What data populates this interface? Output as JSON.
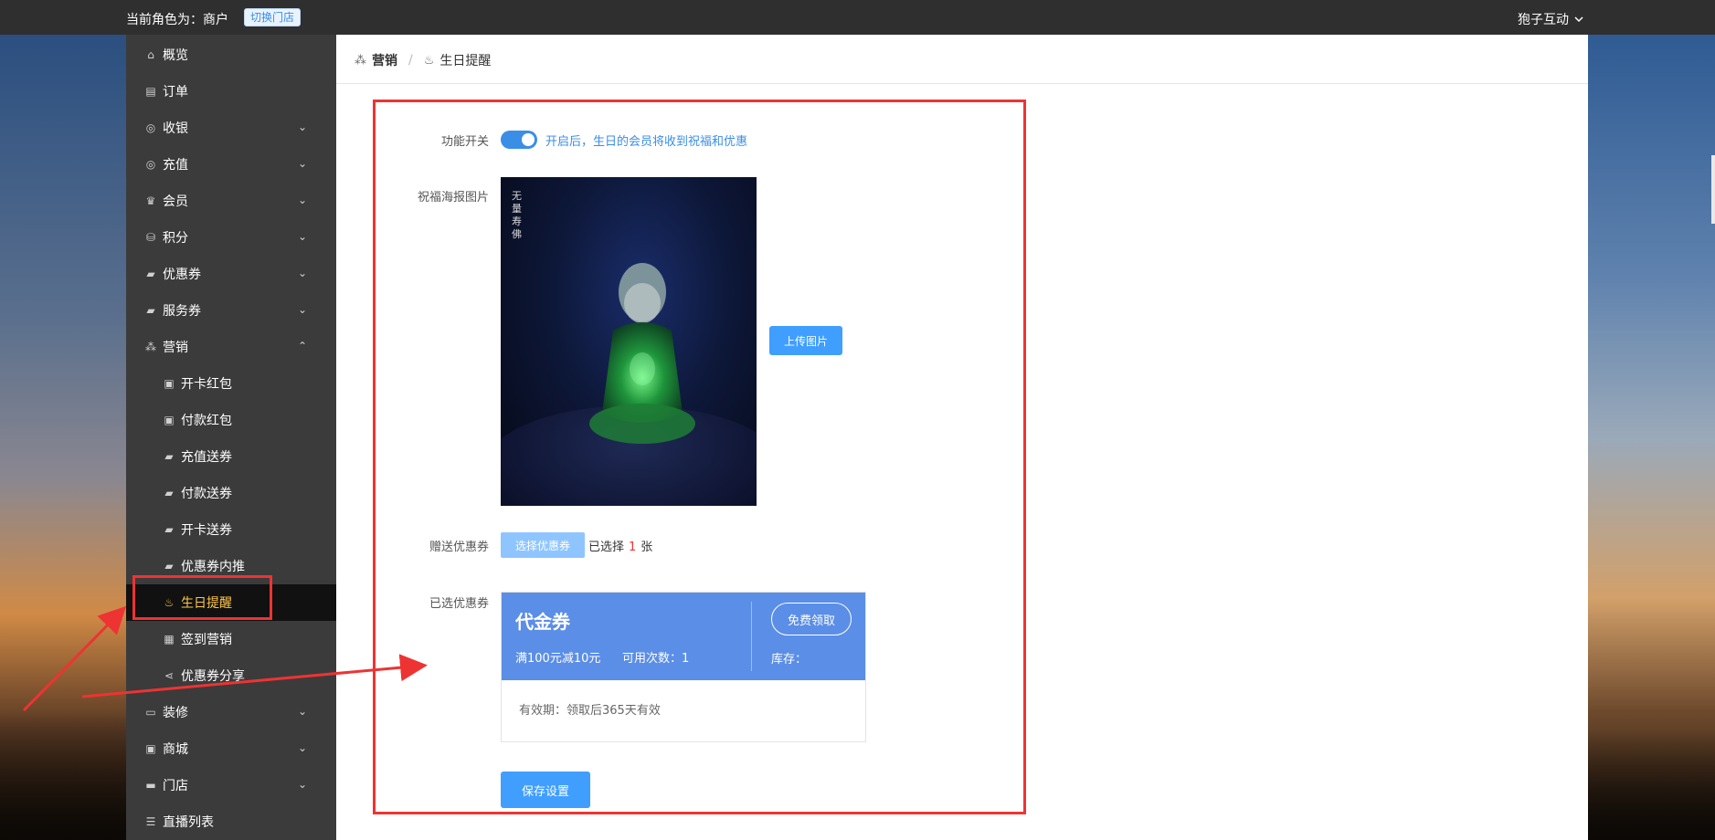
{
  "topbar": {
    "role_text": "当前角色为：商户",
    "switch_store": "切换门店",
    "user_name": "狍子互动"
  },
  "sidebar": {
    "items": [
      {
        "label": "概览",
        "icon": "home-icon",
        "has_chevron": false
      },
      {
        "label": "订单",
        "icon": "order-icon",
        "has_chevron": false
      },
      {
        "label": "收银",
        "icon": "cashier-icon",
        "has_chevron": true
      },
      {
        "label": "充值",
        "icon": "recharge-icon",
        "has_chevron": true
      },
      {
        "label": "会员",
        "icon": "member-icon",
        "has_chevron": true
      },
      {
        "label": "积分",
        "icon": "points-icon",
        "has_chevron": true
      },
      {
        "label": "优惠券",
        "icon": "coupon-icon",
        "has_chevron": true
      },
      {
        "label": "服务券",
        "icon": "service-coupon-icon",
        "has_chevron": true
      },
      {
        "label": "营销",
        "icon": "marketing-icon",
        "has_chevron": true,
        "expanded": true
      }
    ],
    "marketing_sub": [
      {
        "label": "开卡红包",
        "icon": "redpacket-icon"
      },
      {
        "label": "付款红包",
        "icon": "redpacket-icon"
      },
      {
        "label": "充值送券",
        "icon": "ticket-icon"
      },
      {
        "label": "付款送券",
        "icon": "ticket-icon"
      },
      {
        "label": "开卡送券",
        "icon": "ticket-icon"
      },
      {
        "label": "优惠券内推",
        "icon": "ticket-icon"
      },
      {
        "label": "生日提醒",
        "icon": "cake-icon",
        "active": true
      },
      {
        "label": "签到营销",
        "icon": "calendar-icon"
      },
      {
        "label": "优惠券分享",
        "icon": "share-icon"
      }
    ],
    "bottom_items": [
      {
        "label": "装修",
        "icon": "decorate-icon",
        "has_chevron": true
      },
      {
        "label": "商城",
        "icon": "mall-icon",
        "has_chevron": true
      },
      {
        "label": "门店",
        "icon": "store-icon",
        "has_chevron": true
      },
      {
        "label": "直播列表",
        "icon": "list-icon",
        "has_chevron": false
      }
    ]
  },
  "breadcrumb": {
    "parent": "营销",
    "current": "生日提醒"
  },
  "form": {
    "switch_label": "功能开关",
    "switch_on": true,
    "switch_hint": "开启后，生日的会员将收到祝福和优惠",
    "poster_label": "祝福海报图片",
    "poster_vertical_text": "无量寿佛",
    "upload_button": "上传图片",
    "gift_coupon_label": "赠送优惠券",
    "choose_coupon_button": "选择优惠券",
    "selected_prefix": "已选择",
    "selected_count": "1",
    "selected_suffix": "张",
    "selected_coupon_label": "已选优惠券",
    "save_button": "保存设置"
  },
  "coupon": {
    "title": "代金券",
    "rule": "满100元减10元",
    "uses": "可用次数：1",
    "get_button": "免费领取",
    "stock": "库存：",
    "validity": "有效期：领取后365天有效"
  },
  "colors": {
    "accent": "#409eff",
    "coupon_bg": "#5b8ee6",
    "active_nav_text": "#ffc64a",
    "annotation_red": "#ee3333"
  }
}
